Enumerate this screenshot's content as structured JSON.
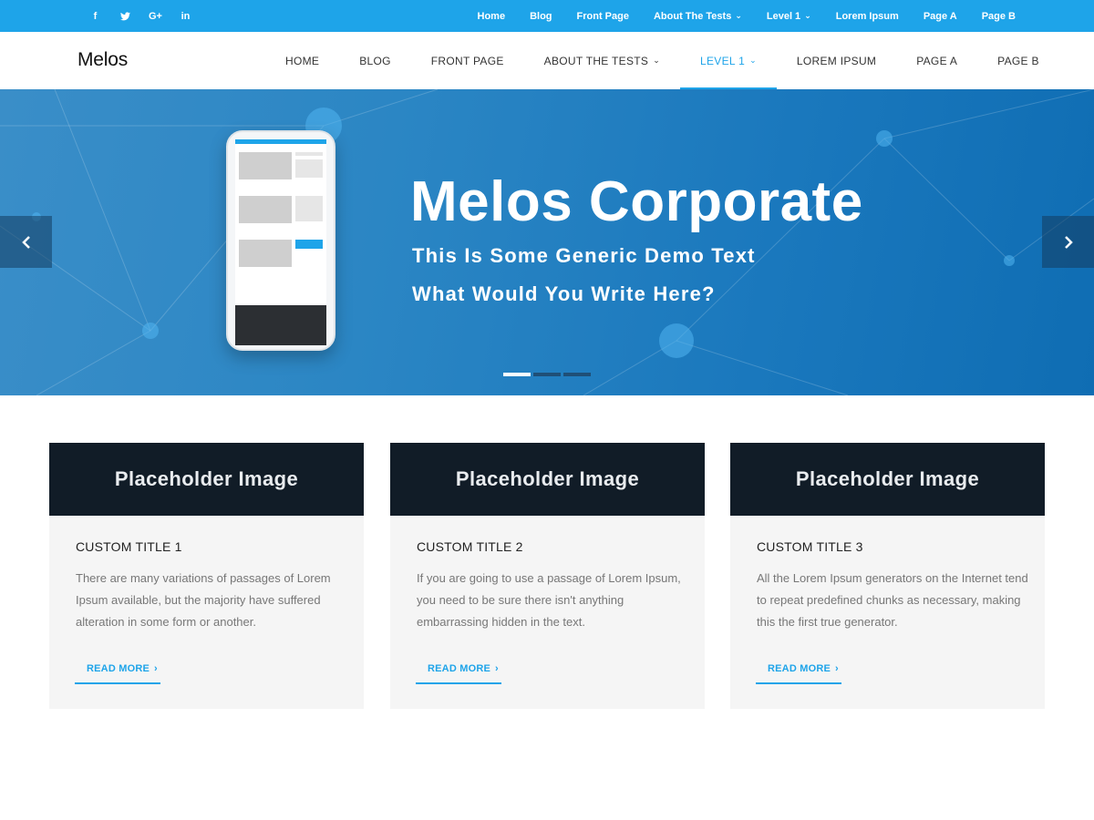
{
  "topbar": {
    "social": [
      {
        "icon": "facebook-icon",
        "glyph": "f"
      },
      {
        "icon": "twitter-icon",
        "glyph": ""
      },
      {
        "icon": "google-plus-icon",
        "glyph": "G+"
      },
      {
        "icon": "linkedin-icon",
        "glyph": "in"
      }
    ],
    "nav": [
      "Home",
      "Blog",
      "Front Page",
      "About The Tests",
      "Level 1",
      "Lorem Ipsum",
      "Page A",
      "Page B"
    ]
  },
  "header": {
    "logo": "Melos",
    "nav": [
      "HOME",
      "BLOG",
      "FRONT PAGE",
      "ABOUT THE TESTS",
      "LEVEL 1",
      "LOREM IPSUM",
      "PAGE A",
      "PAGE B"
    ],
    "active_item": "LEVEL 1"
  },
  "hero": {
    "title": "Melos Corporate",
    "subtitle_line1": "This Is Some Generic Demo Text",
    "subtitle_line2": "What Would You Write Here?",
    "slides_total": 3,
    "active_slide": 1
  },
  "cards": [
    {
      "image_label": "Placeholder Image",
      "title": "CUSTOM TITLE 1",
      "text": "There are many variations of passages of Lorem Ipsum available, but the majority have suffered alteration in some form or another.",
      "link": "READ MORE"
    },
    {
      "image_label": "Placeholder Image",
      "title": "CUSTOM TITLE 2",
      "text": "If you are going to use a passage of Lorem Ipsum, you need to be sure there isn't anything embarrassing hidden in the text.",
      "link": "READ MORE"
    },
    {
      "image_label": "Placeholder Image",
      "title": "CUSTOM TITLE 3",
      "text": "All the Lorem Ipsum generators on the Internet tend to repeat predefined chunks as necessary, making this the first true generator.",
      "link": "READ MORE"
    }
  ],
  "colors": {
    "accent": "#1ea4e9",
    "hero_blue": "#1a78bd",
    "card_image_bg": "#111c27",
    "card_bg": "#f5f5f5"
  }
}
